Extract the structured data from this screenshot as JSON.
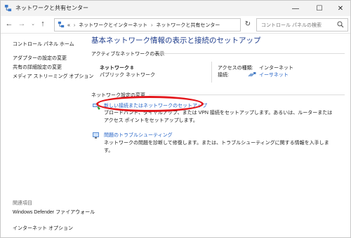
{
  "window": {
    "title": "ネットワークと共有センター",
    "minimize_glyph": "—",
    "maximize_glyph": "☐",
    "close_glyph": "✕"
  },
  "navbar": {
    "back_glyph": "←",
    "forward_glyph": "→",
    "recent_glyph": "⌄",
    "up_glyph": "↑",
    "breadcrumb_prefix": "«",
    "breadcrumbs": [
      "ネットワークとインターネット",
      "ネットワークと共有センター"
    ],
    "breadcrumb_separator": "›",
    "dropdown_glyph": "⌄",
    "refresh_glyph": "↻",
    "search_placeholder": "コントロール パネルの検索"
  },
  "sidebar": {
    "home": "コントロール パネル ホーム",
    "links": [
      "アダプターの設定の変更",
      "共有の詳細設定の変更",
      "メディア ストリーミング オプション"
    ],
    "related_label": "関連項目",
    "related_links": [
      "Windows Defender ファイアウォール",
      "インターネット オプション"
    ]
  },
  "main": {
    "heading": "基本ネットワーク情報の表示と接続のセットアップ",
    "active_section_label": "アクティブなネットワークの表示",
    "network_name": "ネットワーク 8",
    "network_type": "パブリック ネットワーク",
    "access_type_label": "アクセスの種類:",
    "access_type_value": "インターネット",
    "connection_label": "接続:",
    "connection_value": "イーサネット",
    "change_section_label": "ネットワーク設定の変更",
    "tasks": [
      {
        "link": "新しい接続またはネットワークのセットアップ",
        "description": "ブロードバンド、ダイヤルアップ、または VPN 接続をセットアップします。あるいは、ルーターまたはアクセス ポイントをセットアップします。"
      },
      {
        "link": "問題のトラブルシューティング",
        "description": "ネットワークの問題を診断して修復します。または、トラブルシューティングに関する情報を入手します。"
      }
    ]
  },
  "colors": {
    "heading": "#1e3c8c",
    "link": "#1f5fc5",
    "annotation": "#e3161b"
  }
}
